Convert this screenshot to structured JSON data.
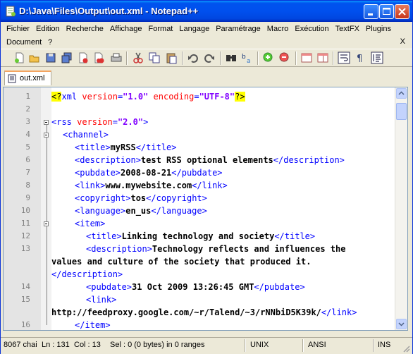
{
  "window": {
    "title": "D:\\Java\\Files\\Output\\out.xml - Notepad++"
  },
  "menu": {
    "row1": [
      "Fichier",
      "Edition",
      "Recherche",
      "Affichage",
      "Format",
      "Langage",
      "Paramétrage",
      "Macro",
      "Exécution",
      "TextFX",
      "Plugins"
    ],
    "row2": [
      "Document",
      "?"
    ],
    "close_doc": "X"
  },
  "toolbar": {
    "icons": [
      "new-file-icon",
      "open-file-icon",
      "save-icon",
      "save-all-icon",
      "close-icon",
      "close-all-icon",
      "print-icon",
      "cut-icon",
      "copy-icon",
      "paste-icon",
      "undo-icon",
      "redo-icon",
      "find-icon",
      "replace-icon",
      "zoom-in-icon",
      "zoom-out-icon",
      "sync-v-icon",
      "sync-h-icon",
      "word-wrap-icon",
      "show-all-chars-icon",
      "indent-guide-icon"
    ]
  },
  "tab": {
    "label": "out.xml"
  },
  "editor": {
    "lines": [
      {
        "num": "1"
      },
      {
        "num": "2"
      },
      {
        "num": "3"
      },
      {
        "num": "4"
      },
      {
        "num": "5"
      },
      {
        "num": "6"
      },
      {
        "num": "7"
      },
      {
        "num": "8"
      },
      {
        "num": "9"
      },
      {
        "num": "10"
      },
      {
        "num": "11"
      },
      {
        "num": "12"
      },
      {
        "num": "13"
      },
      {
        "num": ""
      },
      {
        "num": ""
      },
      {
        "num": "14"
      },
      {
        "num": "15"
      },
      {
        "num": ""
      },
      {
        "num": "16"
      }
    ],
    "text": {
      "l1_pi_open": "<?",
      "l1_xml": "xml ",
      "l1_version_attr": "version",
      "l1_version_val": "\"1.0\"",
      "l1_enc_attr": "encoding",
      "l1_enc_val": "\"UTF-8\"",
      "l1_pi_close": "?>",
      "l3_open": "<rss ",
      "l3_attr": "version",
      "l3_val": "\"2.0\"",
      "l3_close": ">",
      "l4": "<channel>",
      "l5_open": "<title>",
      "l5_text": "myRSS",
      "l5_close": "</title>",
      "l6_open": "<description>",
      "l6_text": "test RSS optional elements",
      "l6_close": "</description>",
      "l7_open": "<pubdate>",
      "l7_text": "2008-08-21",
      "l7_close": "</pubdate>",
      "l8_open": "<link>",
      "l8_text": "www.mywebsite.com",
      "l8_close": "</link>",
      "l9_open": "<copyright>",
      "l9_text": "tos",
      "l9_close": "</copyright>",
      "l10_open": "<language>",
      "l10_text": "en_us",
      "l10_close": "</language>",
      "l11": "<item>",
      "l12_open": "<title>",
      "l12_text": "Linking technology and society",
      "l12_close": "</title>",
      "l13_open": "<description>",
      "l13_text": "Technology reflects and influences the",
      "l13b_text": "values and culture of the society that produced it.",
      "l13c_close": "</description>",
      "l14_open": "<pubdate>",
      "l14_text": "31 Oct 2009 13:26:45 GMT",
      "l14_close": "</pubdate>",
      "l15_open": "<link>",
      "l15b_text": "http://feedproxy.google.com/~r/Talend/~3/rNNbiD5K39k/",
      "l15b_close": "</link>",
      "l16": "</item>"
    }
  },
  "status": {
    "length": "8067 chai",
    "ln": "Ln : 131",
    "col": "Col : 13",
    "sel": "Sel : 0 (0 bytes) in 0 ranges",
    "eol": "UNIX",
    "encoding": "ANSI",
    "mode": "INS"
  },
  "colors": {
    "tag": "#0000FF",
    "attribute": "#FF0000",
    "value": "#8000FF",
    "pi_highlight": "#FFFF00",
    "title_bar": "#0053EE"
  }
}
